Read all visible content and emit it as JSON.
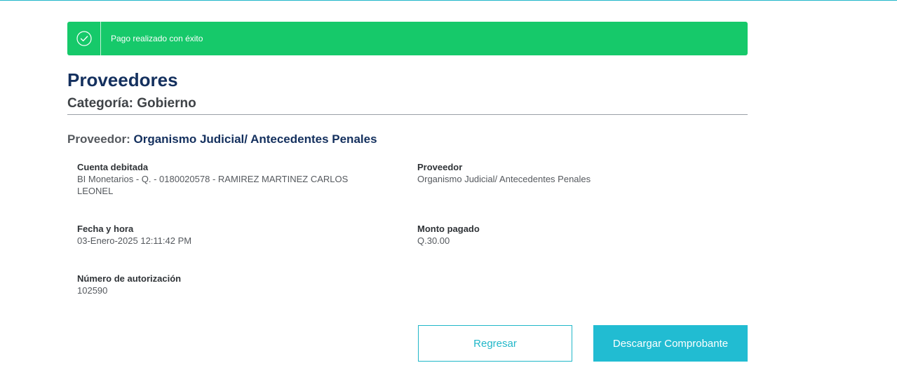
{
  "alert": {
    "message": "Pago realizado con éxito",
    "icon": "check-circle-icon",
    "color": "#16c96a"
  },
  "header": {
    "title": "Proveedores",
    "category": "Categoría: Gobierno"
  },
  "provider": {
    "label": "Proveedor:",
    "name": "Organismo Judicial/ Antecedentes Penales"
  },
  "details": {
    "debited_account": {
      "label": "Cuenta debitada",
      "value": "BI Monetarios - Q. - 0180020578 - RAMIREZ MARTINEZ CARLOS LEONEL"
    },
    "provider": {
      "label": "Proveedor",
      "value": "Organismo Judicial/ Antecedentes Penales"
    },
    "datetime": {
      "label": "Fecha y hora",
      "value": "03-Enero-2025 12:11:42 PM"
    },
    "amount": {
      "label": "Monto pagado",
      "value": "Q.30.00"
    },
    "authorization": {
      "label": "Número de autorización",
      "value": "102590"
    }
  },
  "actions": {
    "back_label": "Regresar",
    "download_label": "Descargar Comprobante"
  },
  "colors": {
    "accent": "#21bcd2",
    "title": "#14305e",
    "success": "#16c96a"
  }
}
